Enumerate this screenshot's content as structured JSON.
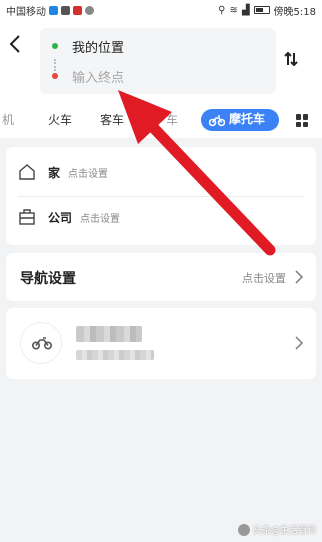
{
  "status_bar": {
    "carrier": "中国移动",
    "time": "傍晚5:18"
  },
  "header": {
    "back_icon": "back-arrow-icon",
    "origin": "我的位置",
    "destination_placeholder": "输入终点",
    "swap_icon": "swap-arrows-icon"
  },
  "tabs": {
    "items": [
      "机",
      "火车",
      "客车",
      "车",
      "摩托车"
    ],
    "active": "摩托车",
    "active_color": "#3b82f6",
    "more_icon": "grid-icon"
  },
  "places": {
    "home_label": "家",
    "home_hint": "点击设置",
    "company_label": "公司",
    "company_hint": "点击设置"
  },
  "nav_settings": {
    "title": "导航设置",
    "hint": "点击设置"
  },
  "moto_card": {
    "icon": "motorcycle-icon"
  },
  "annotation": {
    "color": "#e01b24",
    "icon": "red-arrow-annotation"
  },
  "watermark": {
    "text": "头条@生活百科"
  }
}
